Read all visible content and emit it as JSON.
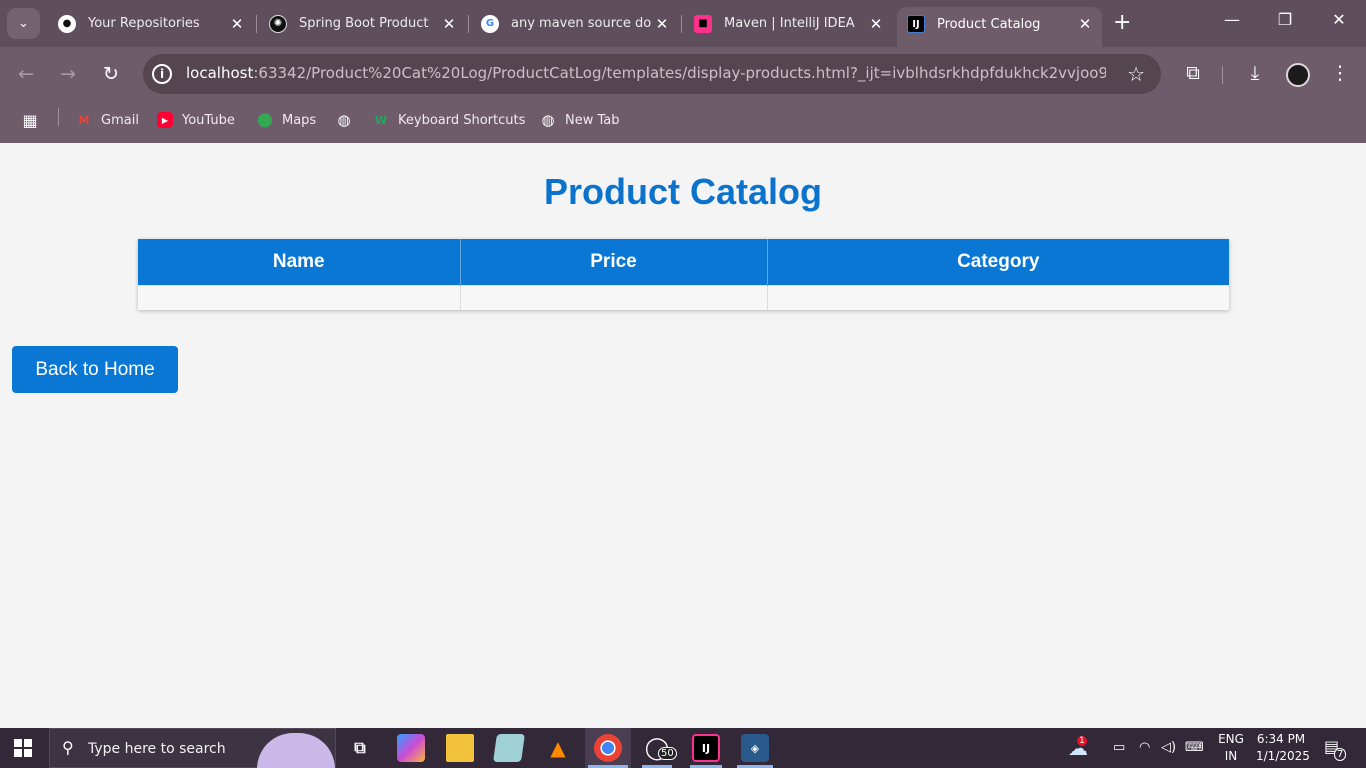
{
  "browser": {
    "tabs": [
      {
        "title": "Your Repositories",
        "favicon": "github-icon"
      },
      {
        "title": "Spring Boot Product",
        "favicon": "openai-icon"
      },
      {
        "title": "any maven source do",
        "favicon": "google-icon"
      },
      {
        "title": "Maven | IntelliJ IDEA",
        "favicon": "intellij-icon"
      },
      {
        "title": "Product Catalog",
        "favicon": "intellij-icon",
        "active": true
      }
    ],
    "url_host": "localhost",
    "url_rest": ":63342/Product%20Cat%20Log/ProductCatLog/templates/display-products.html?_ijt=ivblhdsrkhdpfdukhck2vvjoo9&...",
    "bookmarks": [
      {
        "label": "Gmail"
      },
      {
        "label": "YouTube"
      },
      {
        "label": "Maps"
      },
      {
        "label": ""
      },
      {
        "label": "Keyboard Shortcuts"
      },
      {
        "label": "New Tab"
      }
    ]
  },
  "page": {
    "title": "Product Catalog",
    "table": {
      "headers": [
        "Name",
        "Price",
        "Category"
      ],
      "rows": [
        [
          "",
          "",
          ""
        ]
      ]
    },
    "back_button": "Back to Home"
  },
  "taskbar": {
    "search_placeholder": "Type here to search",
    "whatsapp_badge": "50",
    "weather_badge": "1",
    "language": "ENG",
    "region": "IN",
    "time": "6:34 PM",
    "date": "1/1/2025",
    "notifications": "7"
  },
  "colors": {
    "accent": "#0b77d4",
    "title": "#0b73cc",
    "chrome_frame": "#5f4f5c",
    "chrome_toolbar": "#6f5c6b"
  }
}
